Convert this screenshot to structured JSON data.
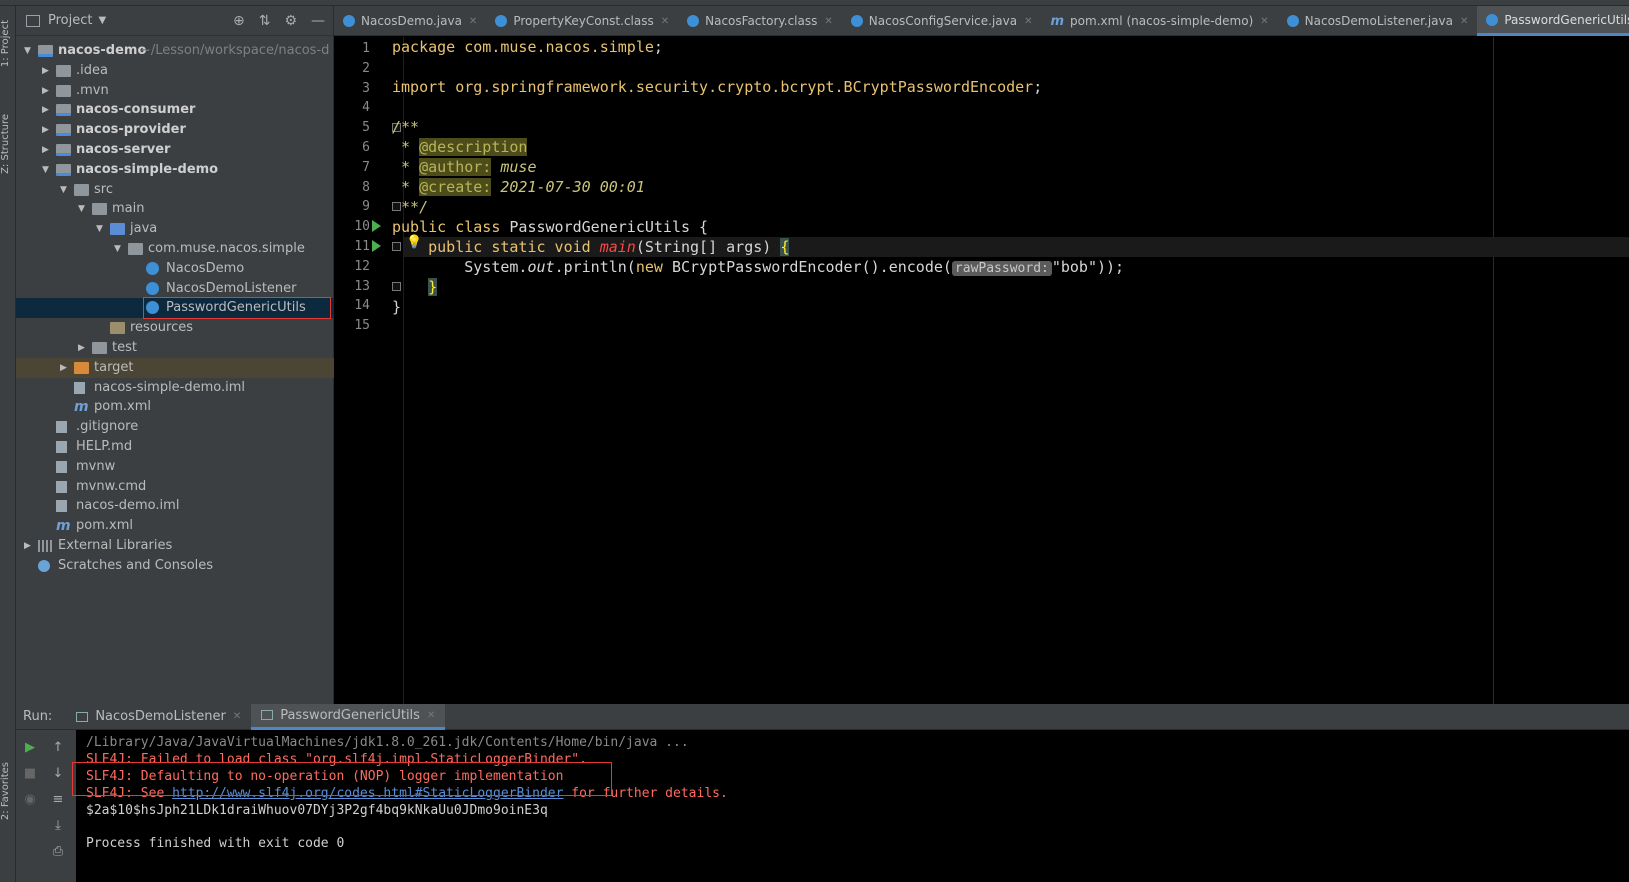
{
  "project_panel": {
    "title": "Project",
    "tree": [
      {
        "label": "nacos-demo",
        "path_hint": "~/Lesson/workspace/nacos-d",
        "depth": 0,
        "arrow": "▼",
        "icon": "module-folder",
        "bold": true
      },
      {
        "label": ".idea",
        "depth": 1,
        "arrow": "▶",
        "icon": "folder"
      },
      {
        "label": ".mvn",
        "depth": 1,
        "arrow": "▶",
        "icon": "folder"
      },
      {
        "label": "nacos-consumer",
        "depth": 1,
        "arrow": "▶",
        "icon": "module-folder",
        "bold": true
      },
      {
        "label": "nacos-provider",
        "depth": 1,
        "arrow": "▶",
        "icon": "module-folder",
        "bold": true
      },
      {
        "label": "nacos-server",
        "depth": 1,
        "arrow": "▶",
        "icon": "module-folder",
        "bold": true
      },
      {
        "label": "nacos-simple-demo",
        "depth": 1,
        "arrow": "▼",
        "icon": "module-folder",
        "bold": true
      },
      {
        "label": "src",
        "depth": 2,
        "arrow": "▼",
        "icon": "folder"
      },
      {
        "label": "main",
        "depth": 3,
        "arrow": "▼",
        "icon": "folder"
      },
      {
        "label": "java",
        "depth": 4,
        "arrow": "▼",
        "icon": "source-folder"
      },
      {
        "label": "com.muse.nacos.simple",
        "depth": 5,
        "arrow": "▼",
        "icon": "package"
      },
      {
        "label": "NacosDemo",
        "depth": 6,
        "arrow": "",
        "icon": "class"
      },
      {
        "label": "NacosDemoListener",
        "depth": 6,
        "arrow": "",
        "icon": "class"
      },
      {
        "label": "PasswordGenericUtils",
        "depth": 6,
        "arrow": "",
        "icon": "class",
        "selected": true
      },
      {
        "label": "resources",
        "depth": 4,
        "arrow": "",
        "icon": "resources-folder"
      },
      {
        "label": "test",
        "depth": 3,
        "arrow": "▶",
        "icon": "folder"
      },
      {
        "label": "target",
        "depth": 2,
        "arrow": "▶",
        "icon": "excluded-folder",
        "excluded": true
      },
      {
        "label": "nacos-simple-demo.iml",
        "depth": 2,
        "arrow": "",
        "icon": "file"
      },
      {
        "label": "pom.xml",
        "depth": 2,
        "arrow": "",
        "icon": "maven"
      },
      {
        "label": ".gitignore",
        "depth": 1,
        "arrow": "",
        "icon": "file"
      },
      {
        "label": "HELP.md",
        "depth": 1,
        "arrow": "",
        "icon": "file"
      },
      {
        "label": "mvnw",
        "depth": 1,
        "arrow": "",
        "icon": "file"
      },
      {
        "label": "mvnw.cmd",
        "depth": 1,
        "arrow": "",
        "icon": "file"
      },
      {
        "label": "nacos-demo.iml",
        "depth": 1,
        "arrow": "",
        "icon": "file"
      },
      {
        "label": "pom.xml",
        "depth": 1,
        "arrow": "",
        "icon": "maven"
      },
      {
        "label": "External Libraries",
        "depth": 0,
        "arrow": "▶",
        "icon": "library"
      },
      {
        "label": "Scratches and Consoles",
        "depth": 0,
        "arrow": "",
        "icon": "scratches"
      }
    ]
  },
  "left_strip": {
    "project": "1: Project",
    "structure": "Z: Structure",
    "favorites": "2: Favorites"
  },
  "editor_tabs": [
    {
      "label": "NacosDemo.java",
      "icon": "class",
      "active": false
    },
    {
      "label": "PropertyKeyConst.class",
      "icon": "class",
      "active": false
    },
    {
      "label": "NacosFactory.class",
      "icon": "class",
      "active": false
    },
    {
      "label": "NacosConfigService.java",
      "icon": "class",
      "active": false
    },
    {
      "label": "pom.xml (nacos-simple-demo)",
      "icon": "maven",
      "active": false
    },
    {
      "label": "NacosDemoListener.java",
      "icon": "class",
      "active": false
    },
    {
      "label": "PasswordGenericUtils.java",
      "icon": "class",
      "active": true
    }
  ],
  "code": {
    "line_numbers": [
      "1",
      "2",
      "3",
      "4",
      "5",
      "6",
      "7",
      "8",
      "9",
      "10",
      "11",
      "12",
      "13",
      "14",
      "15"
    ],
    "l1_kw": "package",
    "l1_pkg": " com.muse.nacos.simple",
    "l1_end": ";",
    "l3_kw": "import",
    "l3_pkg": " org.springframework.security.crypto.bcrypt.BCryptPasswordEncoder",
    "l3_end": ";",
    "l5": "/**",
    "l6_star": " * ",
    "l6_tag": "@description",
    "l7_star": " * ",
    "l7_tag": "@author:",
    "l7_val": " muse",
    "l8_star": " * ",
    "l8_tag": "@create:",
    "l8_val": " 2021-07-30 00:01",
    "l9": " **/",
    "l10_kw": "public class",
    "l10_name": " PasswordGenericUtils {",
    "l11_indent": "    ",
    "l11_kw": "public static void",
    "l11_fn": "main",
    "l11_rest": "(String[] args) ",
    "l11_brace": "{",
    "l12_indent": "        ",
    "l12_a": "System.",
    "l12_out": "out",
    "l12_b": ".println(",
    "l12_new": "new",
    "l12_c": " BCryptPasswordEncoder().encode(",
    "l12_hint": "rawPassword:",
    "l12_str": "\"bob\"",
    "l12_end": "));",
    "l13_indent": "    ",
    "l13_brace": "}",
    "l14": "}"
  },
  "run_panel": {
    "label": "Run:",
    "tabs": [
      {
        "label": "NacosDemoListener",
        "active": false
      },
      {
        "label": "PasswordGenericUtils",
        "active": true
      }
    ],
    "console": {
      "cmd": "/Library/Java/JavaVirtualMachines/jdk1.8.0_261.jdk/Contents/Home/bin/java ...",
      "err1": "SLF4J: Failed to load class \"org.slf4j.impl.StaticLoggerBinder\".",
      "err2": "SLF4J: Defaulting to no-operation (NOP) logger implementation",
      "err3_pre": "SLF4J: See ",
      "err3_link": "http://www.slf4j.org/codes.html#StaticLoggerBinder",
      "err3_post": " for further details.",
      "hash": "$2a$10$hsJph21LDk1draiWhuov07DYj3P2gf4bq9kNkaUu0JDmo9oinE3q",
      "exit": "Process finished with exit code 0"
    }
  }
}
